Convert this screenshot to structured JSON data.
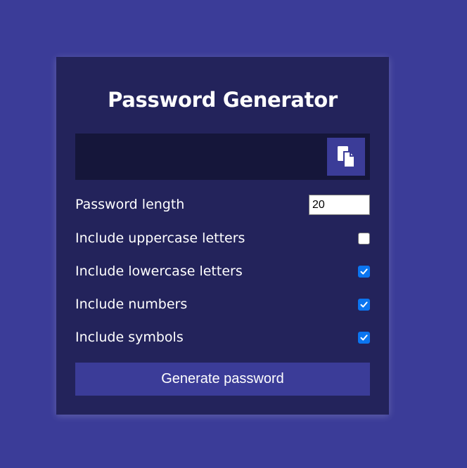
{
  "app": {
    "title": "Password Generator"
  },
  "result": {
    "value": ""
  },
  "settings": {
    "length": {
      "label": "Password length",
      "value": "20"
    },
    "uppercase": {
      "label": "Include uppercase letters",
      "checked": false
    },
    "lowercase": {
      "label": "Include lowercase letters",
      "checked": true
    },
    "numbers": {
      "label": "Include numbers",
      "checked": true
    },
    "symbols": {
      "label": "Include symbols",
      "checked": true
    }
  },
  "actions": {
    "generate_label": "Generate password",
    "copy_icon": "clipboard-icon"
  },
  "colors": {
    "page_background": "#3b3c98",
    "card_background": "#23235b",
    "result_background": "#15163a",
    "accent": "#3b3c98",
    "checkbox_checked": "#0b75f0"
  }
}
